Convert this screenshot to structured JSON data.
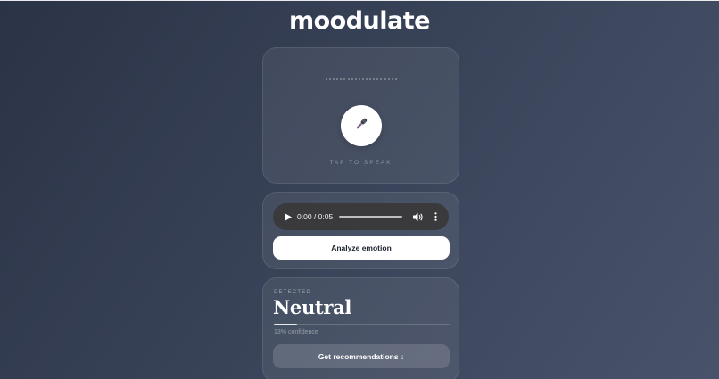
{
  "app": {
    "logo": "moodulate"
  },
  "recorder": {
    "mic_icon": "microphone-icon",
    "tap_label": "TAP TO SPEAK"
  },
  "player": {
    "play_icon": "play-icon",
    "time": "0:00 / 0:05",
    "volume_icon": "volume-icon",
    "more_icon": "more-vertical-icon",
    "analyze_label": "Analyze emotion"
  },
  "result": {
    "detected_label": "DETECTED",
    "emotion": "Neutral",
    "confidence": 0.13,
    "confidence_text": "13% confidence",
    "recommendations_label": "Get recommendations ↓"
  },
  "colors": {
    "background_start": "#2b3346",
    "background_end": "#48526a",
    "button_primary": "#ffffff",
    "player_bg": "#3a3a3d"
  }
}
